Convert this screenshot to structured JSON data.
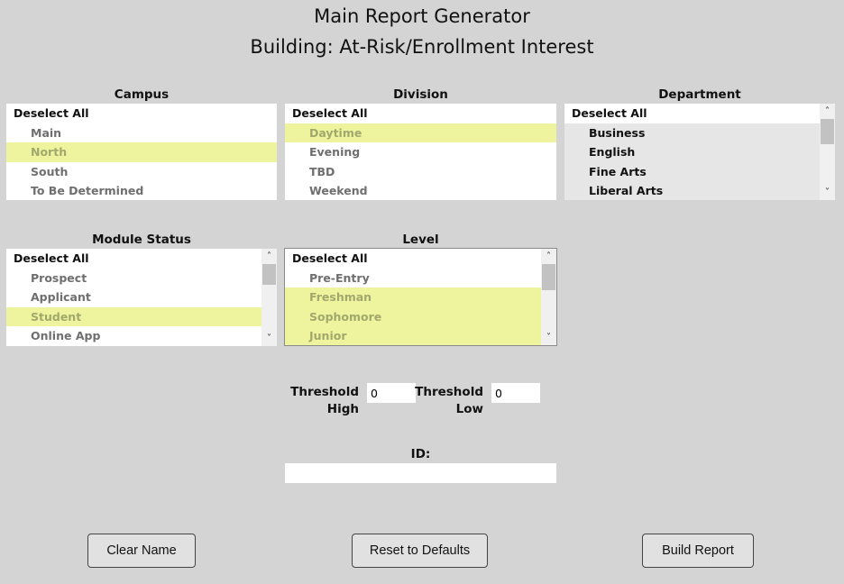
{
  "header": {
    "title": "Main Report Generator",
    "subtitle": "Building: At-Risk/Enrollment Interest"
  },
  "panels": {
    "campus": {
      "label": "Campus",
      "items": [
        {
          "label": "Deselect All",
          "selected": false
        },
        {
          "label": "Main",
          "selected": false
        },
        {
          "label": "North",
          "selected": true
        },
        {
          "label": "South",
          "selected": false
        },
        {
          "label": "To Be Determined",
          "selected": false
        }
      ]
    },
    "division": {
      "label": "Division",
      "items": [
        {
          "label": "Deselect All",
          "selected": false
        },
        {
          "label": "Daytime",
          "selected": true
        },
        {
          "label": "Evening",
          "selected": false
        },
        {
          "label": "TBD",
          "selected": false
        },
        {
          "label": "Weekend",
          "selected": false
        }
      ]
    },
    "department": {
      "label": "Department",
      "items": [
        {
          "label": "Deselect All",
          "selected": false
        },
        {
          "label": "Business",
          "selected": false
        },
        {
          "label": "English",
          "selected": false
        },
        {
          "label": "Fine Arts",
          "selected": false
        },
        {
          "label": "Liberal Arts",
          "selected": false
        }
      ]
    },
    "module_status": {
      "label": "Module Status",
      "items": [
        {
          "label": "Deselect All",
          "selected": false
        },
        {
          "label": "Prospect",
          "selected": false
        },
        {
          "label": "Applicant",
          "selected": false
        },
        {
          "label": "Student",
          "selected": true
        },
        {
          "label": "Online App",
          "selected": false
        }
      ]
    },
    "level": {
      "label": "Level",
      "items": [
        {
          "label": "Deselect All",
          "selected": false
        },
        {
          "label": "Pre-Entry",
          "selected": false
        },
        {
          "label": "Freshman",
          "selected": true
        },
        {
          "label": "Sophomore",
          "selected": true
        },
        {
          "label": "Junior",
          "selected": true
        }
      ]
    }
  },
  "thresholds": {
    "high_label_line1": "Threshold",
    "high_label_line2": "High",
    "high_value": "0",
    "low_label_line1": "Threshold",
    "low_label_line2": "Low",
    "low_value": "0"
  },
  "id_field": {
    "label": "ID:",
    "value": ""
  },
  "buttons": {
    "clear_name": "Clear Name",
    "reset_defaults": "Reset to Defaults",
    "build_report": "Build Report"
  },
  "colors": {
    "background": "#d4d4d4",
    "selected_row": "#eef49e",
    "selected_text": "#a2a86c",
    "list_background": "#ffffff",
    "department_row_background": "#e6e6e6"
  },
  "icons": {
    "scroll_up": "chevron-up-icon",
    "scroll_down": "chevron-down-icon"
  }
}
